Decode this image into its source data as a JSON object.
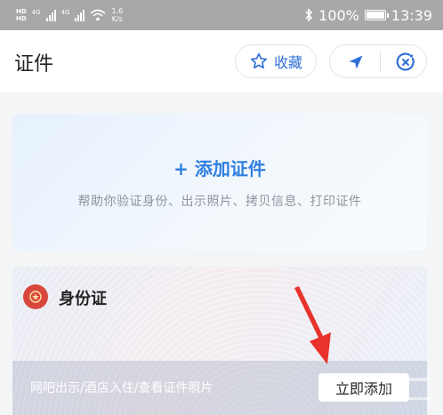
{
  "status_bar": {
    "hd_top": "HD",
    "hd_bottom": "HD",
    "net1": "4G",
    "net2": "4G",
    "speed_value": "1.6",
    "speed_unit": "K/s",
    "battery": "100%",
    "time": "13:39",
    "icons": [
      "signal-icon",
      "wifi-icon",
      "bluetooth-icon",
      "battery-icon"
    ]
  },
  "header": {
    "title": "证件",
    "favorite_label": "收藏",
    "icons": [
      "star-icon",
      "location-arrow-icon",
      "close-circle-icon"
    ]
  },
  "add_card": {
    "title": "+ 添加证件",
    "description": "帮助你验证身份、出示照片、拷贝信息、打印证件"
  },
  "id_card": {
    "title": "身份证",
    "description": "网吧出示/酒店入住/查看证件照片",
    "button_label": "立即添加"
  },
  "colors": {
    "accent": "#2f7fe0",
    "favorite_text": "#2f6fd6",
    "emblem": "#d8473e",
    "arrow": "#e8332c"
  }
}
